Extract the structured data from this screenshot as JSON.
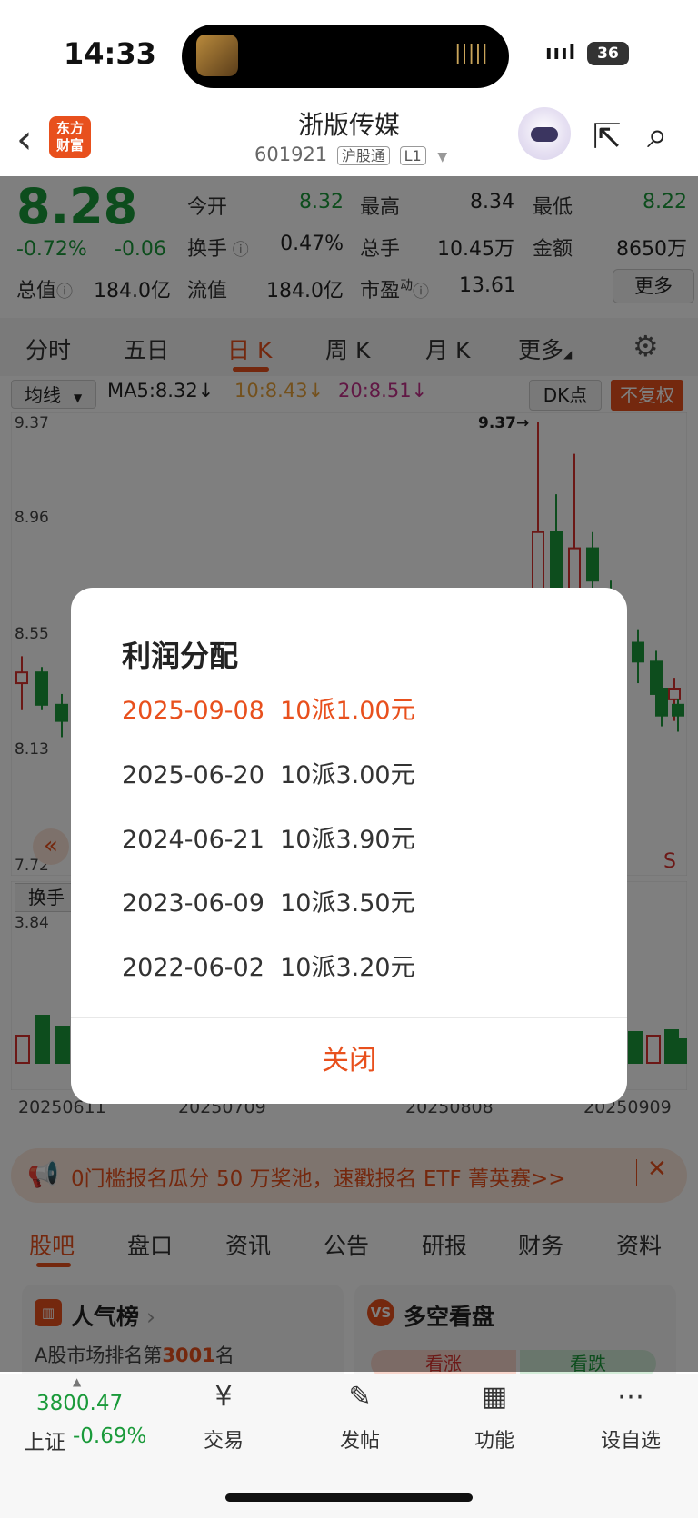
{
  "status_bar": {
    "time": "14:33",
    "battery": "36",
    "signal": "ıııl"
  },
  "header": {
    "back_icon": "‹",
    "logo_text": "东方\n财富",
    "stock_name": "浙版传媒",
    "stock_code": "601921",
    "tag_hk": "沪股通",
    "tag_level": "L1"
  },
  "quote": {
    "price": "8.28",
    "pct_change": "-0.72%",
    "change": "-0.06",
    "rows": [
      [
        {
          "label": "今开",
          "value": "8.32",
          "green": true
        },
        {
          "label": "最高",
          "value": "8.34",
          "green": false
        },
        {
          "label": "最低",
          "value": "8.22",
          "green": true
        }
      ],
      [
        {
          "label": "换手",
          "value": "0.47%",
          "green": false
        },
        {
          "label": "总手",
          "value": "10.45万",
          "green": false
        },
        {
          "label": "金额",
          "value": "8650万",
          "green": false
        }
      ],
      [
        {
          "label": "总值",
          "value": "184.0亿",
          "green": false
        },
        {
          "label": "流值",
          "value": "184.0亿",
          "green": false
        },
        {
          "label": "市盈",
          "value": "13.61",
          "green": false
        }
      ]
    ],
    "pe_sup": "动",
    "more_button": "更多"
  },
  "k_tabs": [
    "分时",
    "五日",
    "日 K",
    "周 K",
    "月 K",
    "更多"
  ],
  "chart_toolbar": {
    "ma_select": "均线",
    "ma5": "MA5:8.32↓",
    "ma10": "10:8.43↓",
    "ma20": "20:8.51↓",
    "dk": "DK点",
    "fq": "不复权"
  },
  "chart_labels": {
    "y_ticks": [
      "9.37",
      "8.96",
      "8.55",
      "8.13",
      "7.72"
    ],
    "high_marker": "9.37→",
    "vol_select": "换手",
    "vol_max": "3.84",
    "dates": [
      "20250611",
      "20250709",
      "20250808",
      "20250909"
    ],
    "s_marker": "S",
    "nav_left": "«"
  },
  "chart_data": {
    "type": "candlestick",
    "ylim": [
      7.72,
      9.37
    ],
    "candles": [
      {
        "o": 8.4,
        "h": 8.5,
        "l": 8.3,
        "c": 8.44
      },
      {
        "o": 8.44,
        "h": 8.46,
        "l": 8.3,
        "c": 8.32
      },
      {
        "o": 8.32,
        "h": 8.36,
        "l": 8.2,
        "c": 8.26
      },
      {
        "o": 8.26,
        "h": 8.34,
        "l": 8.24,
        "c": 8.32
      },
      {
        "o": 8.32,
        "h": 8.34,
        "l": 8.16,
        "c": 8.2
      },
      {
        "o": 8.3,
        "h": 9.37,
        "l": 8.5,
        "c": 8.96
      },
      {
        "o": 8.96,
        "h": 9.1,
        "l": 8.55,
        "c": 8.7
      },
      {
        "o": 8.72,
        "h": 9.25,
        "l": 8.7,
        "c": 8.9
      },
      {
        "o": 8.9,
        "h": 8.96,
        "l": 8.7,
        "c": 8.78
      },
      {
        "o": 8.7,
        "h": 8.78,
        "l": 8.58,
        "c": 8.64
      },
      {
        "o": 8.55,
        "h": 8.6,
        "l": 8.4,
        "c": 8.48
      },
      {
        "o": 8.48,
        "h": 8.52,
        "l": 8.3,
        "c": 8.36
      },
      {
        "o": 8.34,
        "h": 8.42,
        "l": 8.26,
        "c": 8.38
      },
      {
        "o": 8.38,
        "h": 8.4,
        "l": 8.24,
        "c": 8.28
      },
      {
        "o": 8.32,
        "h": 8.34,
        "l": 8.22,
        "c": 8.28
      }
    ],
    "volume_max": 3.84
  },
  "promo_banner": {
    "text": "0门槛报名瓜分 50 万奖池，速戳报名 ETF 菁英赛>>",
    "close": "✕"
  },
  "bottom_tabs": [
    "股吧",
    "盘口",
    "资讯",
    "公告",
    "研报",
    "财务",
    "资料"
  ],
  "cards": {
    "popularity": {
      "title": "人气榜",
      "sub_prefix": "A股市场排名第",
      "rank": "3001",
      "sub_suffix": "名"
    },
    "sentiment": {
      "title": "多空看盘",
      "bull": "看涨",
      "bear": "看跌"
    }
  },
  "bottom_nav": {
    "index_value": "3800.47",
    "index_name": "上证",
    "index_change": "-0.69%",
    "items": [
      {
        "label": "交易",
        "icon": "¥"
      },
      {
        "label": "发帖",
        "icon": "✎"
      },
      {
        "label": "功能",
        "icon": "▦"
      },
      {
        "label": "设自选",
        "icon": "⋯"
      }
    ]
  },
  "dialog": {
    "title": "利润分配",
    "rows": [
      {
        "date": "2025-09-08",
        "plan": "10派1.00元",
        "highlight": true
      },
      {
        "date": "2025-06-20",
        "plan": "10派3.00元",
        "highlight": false
      },
      {
        "date": "2024-06-21",
        "plan": "10派3.90元",
        "highlight": false
      },
      {
        "date": "2023-06-09",
        "plan": "10派3.50元",
        "highlight": false
      },
      {
        "date": "2022-06-02",
        "plan": "10派3.20元",
        "highlight": false
      }
    ],
    "close_label": "关闭"
  },
  "colors": {
    "accent": "#e8501d",
    "down": "#1a9a3a",
    "up": "#d9302c"
  }
}
